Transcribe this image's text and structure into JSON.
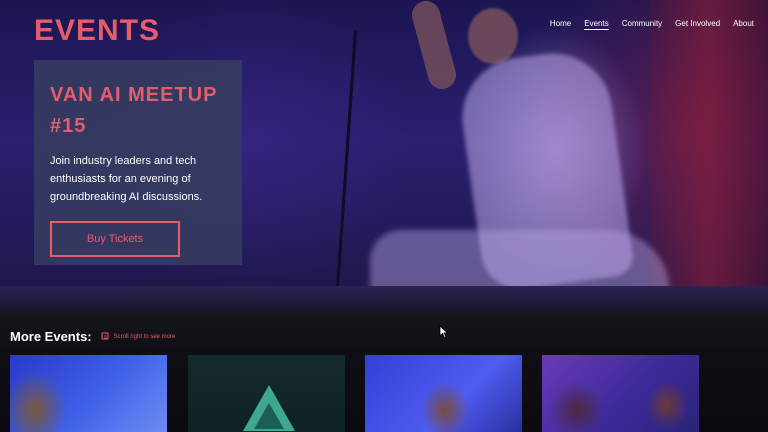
{
  "brand": {
    "title": "EVENTS"
  },
  "nav": {
    "items": [
      {
        "label": "Home"
      },
      {
        "label": "Events"
      },
      {
        "label": "Community"
      },
      {
        "label": "Get Involved"
      },
      {
        "label": "About"
      }
    ],
    "active": "Events"
  },
  "featured": {
    "title": "VAN AI MEETUP #15",
    "description": "Join industry leaders and tech enthusiasts for an evening of groundbreaking AI discussions.",
    "cta_label": "Buy Tickets"
  },
  "more_events": {
    "heading": "More Events:",
    "hint": "Scroll right to see more",
    "hint_icon": "scroll-icon",
    "thumbnails": [
      {
        "icon": "photo-person-icon"
      },
      {
        "icon": "triangle-logo-icon"
      },
      {
        "icon": "photo-person-icon"
      },
      {
        "icon": "photo-person-icon"
      }
    ]
  },
  "colors": {
    "accent": "#e35d6a",
    "card_bg": "#363a60",
    "page_bg": "#0c0c12",
    "text": "#ffffff"
  }
}
